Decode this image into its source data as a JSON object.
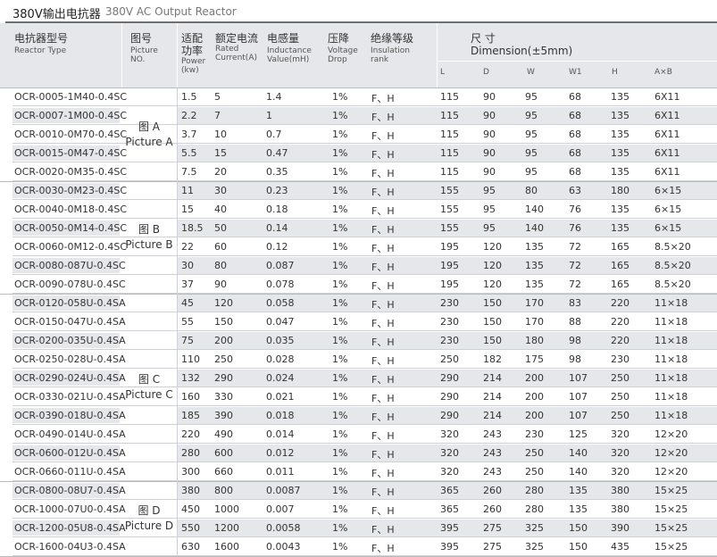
{
  "title": {
    "cn": "380V输出电抗器",
    "en": "380V AC Output Reactor"
  },
  "headers": {
    "model": {
      "cn": "电抗器型号",
      "en": "Reactor Type"
    },
    "picture": {
      "cn": "图号",
      "en1": "Picture",
      "en2": "NO."
    },
    "power": {
      "cn": "适配功率",
      "en1": "Power",
      "en2": "(kw)"
    },
    "current": {
      "cn": "额定电流",
      "en1": "Rated",
      "en2": "Current(A)"
    },
    "inductance": {
      "cn": "电感量",
      "en1": "Inductance",
      "en2": "Value(mH)"
    },
    "drop": {
      "cn": "压降",
      "en1": "Voltage",
      "en2": "Drop"
    },
    "insulation": {
      "cn": "绝缘等级",
      "en1": "Insulation",
      "en2": "rank"
    },
    "dimension": {
      "cn": "尺 寸",
      "en": "Dimension(±5mm)"
    },
    "sub": [
      "L",
      "D",
      "W",
      "W1",
      "H",
      "A×B"
    ]
  },
  "groups": [
    {
      "cn": "图 A",
      "en": "Picture A"
    },
    {
      "cn": "图 B",
      "en": "Picture B"
    },
    {
      "cn": "图 C",
      "en": "Picture C"
    },
    {
      "cn": "图 D",
      "en": "Picture D"
    }
  ],
  "rows": [
    [
      "OCR-0005-1M40-0.4SC",
      "1.5",
      "5",
      "1.4",
      "1%",
      "F、H",
      "115",
      "90",
      "95",
      "68",
      "135",
      "6X11"
    ],
    [
      "OCR-0007-1M00-0.4SC",
      "2.2",
      "7",
      "1",
      "1%",
      "F、H",
      "115",
      "90",
      "95",
      "68",
      "135",
      "6X11"
    ],
    [
      "OCR-0010-0M70-0.4SC",
      "3.7",
      "10",
      "0.7",
      "1%",
      "F、H",
      "115",
      "90",
      "95",
      "68",
      "135",
      "6X11"
    ],
    [
      "OCR-0015-0M47-0.4SC",
      "5.5",
      "15",
      "0.47",
      "1%",
      "F、H",
      "115",
      "90",
      "95",
      "68",
      "135",
      "6X11"
    ],
    [
      "OCR-0020-0M35-0.4SC",
      "7.5",
      "20",
      "0.35",
      "1%",
      "F、H",
      "115",
      "90",
      "95",
      "68",
      "135",
      "6X11"
    ],
    [
      "OCR-0030-0M23-0.4SC",
      "11",
      "30",
      "0.23",
      "1%",
      "F、H",
      "155",
      "95",
      "80",
      "63",
      "180",
      "6×15"
    ],
    [
      "OCR-0040-0M18-0.4SC",
      "15",
      "40",
      "0.18",
      "1%",
      "F、H",
      "155",
      "95",
      "140",
      "76",
      "135",
      "6×15"
    ],
    [
      "OCR-0050-0M14-0.4SC",
      "18.5",
      "50",
      "0.14",
      "1%",
      "F、H",
      "155",
      "95",
      "140",
      "76",
      "135",
      "6×15"
    ],
    [
      "OCR-0060-0M12-0.4SC",
      "22",
      "60",
      "0.12",
      "1%",
      "F、H",
      "195",
      "120",
      "135",
      "72",
      "165",
      "8.5×20"
    ],
    [
      "OCR-0080-087U-0.4SC",
      "30",
      "80",
      "0.087",
      "1%",
      "F、H",
      "195",
      "120",
      "135",
      "72",
      "165",
      "8.5×20"
    ],
    [
      "OCR-0090-078U-0.4SC",
      "37",
      "90",
      "0.078",
      "1%",
      "F、H",
      "195",
      "120",
      "135",
      "72",
      "165",
      "8.5×20"
    ],
    [
      "OCR-0120-058U-0.4SA",
      "45",
      "120",
      "0.058",
      "1%",
      "F、H",
      "230",
      "150",
      "170",
      "83",
      "220",
      "11×18"
    ],
    [
      "OCR-0150-047U-0.4SA",
      "55",
      "150",
      "0.047",
      "1%",
      "F、H",
      "230",
      "150",
      "170",
      "88",
      "220",
      "11×18"
    ],
    [
      "OCR-0200-035U-0.4SA",
      "75",
      "200",
      "0.035",
      "1%",
      "F、H",
      "230",
      "150",
      "180",
      "98",
      "220",
      "11×18"
    ],
    [
      "OCR-0250-028U-0.4SA",
      "110",
      "250",
      "0.028",
      "1%",
      "F、H",
      "250",
      "182",
      "175",
      "98",
      "230",
      "11×18"
    ],
    [
      "OCR-0290-024U-0.4SA",
      "132",
      "290",
      "0.024",
      "1%",
      "F、H",
      "290",
      "214",
      "200",
      "107",
      "250",
      "11×18"
    ],
    [
      "OCR-0330-021U-0.4SA",
      "160",
      "330",
      "0.021",
      "1%",
      "F、H",
      "290",
      "214",
      "200",
      "107",
      "250",
      "11×18"
    ],
    [
      "OCR-0390-018U-0.4SA",
      "185",
      "390",
      "0.018",
      "1%",
      "F、H",
      "290",
      "214",
      "200",
      "107",
      "250",
      "11×18"
    ],
    [
      "OCR-0490-014U-0.4SA",
      "220",
      "490",
      "0.014",
      "1%",
      "F、H",
      "320",
      "243",
      "230",
      "125",
      "320",
      "12×20"
    ],
    [
      "OCR-0600-012U-0.4SA",
      "280",
      "600",
      "0.012",
      "1%",
      "F、H",
      "320",
      "243",
      "250",
      "140",
      "320",
      "12×20"
    ],
    [
      "OCR-0660-011U-0.4SA",
      "300",
      "660",
      "0.011",
      "1%",
      "F、H",
      "320",
      "243",
      "250",
      "140",
      "320",
      "12×20"
    ],
    [
      "OCR-0800-08U7-0.4SA",
      "380",
      "800",
      "0.0087",
      "1%",
      "F、H",
      "365",
      "260",
      "280",
      "135",
      "380",
      "15×25"
    ],
    [
      "OCR-1000-07U0-0.4SA",
      "450",
      "1000",
      "0.007",
      "1%",
      "F、H",
      "365",
      "260",
      "280",
      "135",
      "380",
      "15×25"
    ],
    [
      "OCR-1200-05U8-0.4SA",
      "550",
      "1200",
      "0.0058",
      "1%",
      "F、H",
      "395",
      "275",
      "325",
      "150",
      "390",
      "15×25"
    ],
    [
      "OCR-1600-04U3-0.4SA",
      "630",
      "1600",
      "0.0043",
      "1%",
      "F、H",
      "395",
      "275",
      "325",
      "150",
      "435",
      "15×25"
    ]
  ]
}
